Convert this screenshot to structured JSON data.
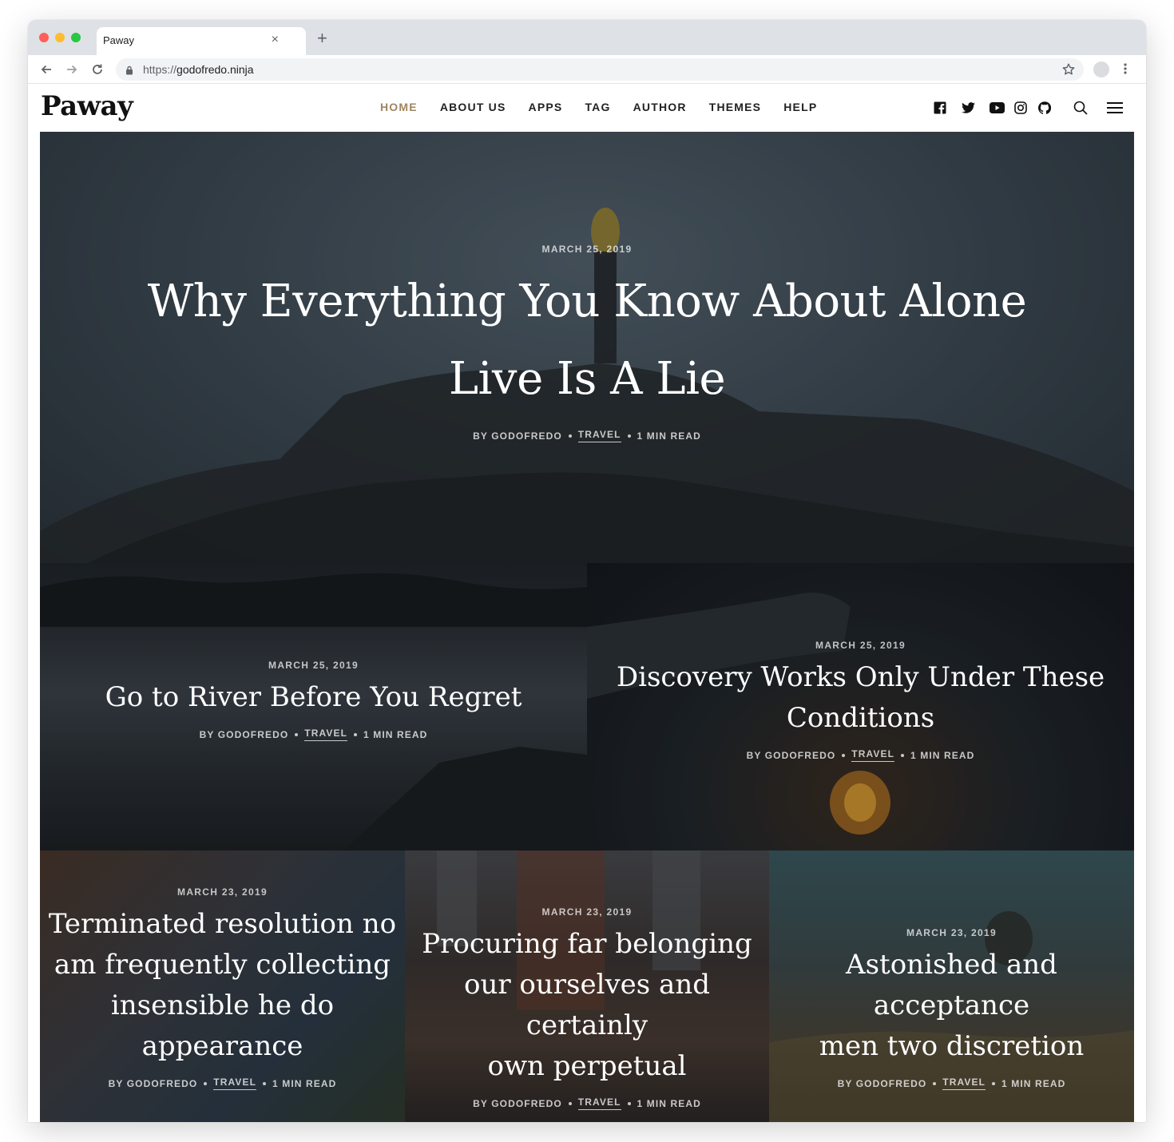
{
  "browser": {
    "tab_title": "Paway",
    "tab_close": "×",
    "new_tab": "+",
    "url_protocol": "https://",
    "url_host": "godofredo.ninja"
  },
  "site": {
    "logo": "Paway",
    "menu": [
      "HOME",
      "ABOUT US",
      "APPS",
      "TAG",
      "AUTHOR",
      "THEMES",
      "HELP"
    ],
    "active_menu": "HOME",
    "accent_color": "#a08660",
    "social_icons": [
      "facebook-icon",
      "twitter-icon",
      "youtube-icon",
      "instagram-icon",
      "github-icon"
    ]
  },
  "posts": [
    {
      "date": "MARCH 25, 2019",
      "title_lines": [
        "Why Everything You Know About Alone",
        "Live Is A Lie"
      ],
      "author": "BY GODOFREDO",
      "tag": "TRAVEL",
      "read": "1 MIN READ"
    },
    {
      "date": "MARCH 25, 2019",
      "title_lines": [
        "Go to River Before You Regret"
      ],
      "author": "BY GODOFREDO",
      "tag": "TRAVEL",
      "read": "1 MIN READ"
    },
    {
      "date": "MARCH 25, 2019",
      "title_lines": [
        "Discovery Works Only Under These",
        "Conditions"
      ],
      "author": "BY GODOFREDO",
      "tag": "TRAVEL",
      "read": "1 MIN READ"
    },
    {
      "date": "MARCH 23, 2019",
      "title_lines": [
        "Terminated resolution no",
        "am frequently collecting",
        "insensible he do",
        "appearance"
      ],
      "author": "BY GODOFREDO",
      "tag": "TRAVEL",
      "read": "1 MIN READ"
    },
    {
      "date": "MARCH 23, 2019",
      "title_lines": [
        "Procuring far belonging",
        "our ourselves and certainly",
        "own perpetual"
      ],
      "author": "BY GODOFREDO",
      "tag": "TRAVEL",
      "read": "1 MIN READ"
    },
    {
      "date": "MARCH 23, 2019",
      "title_lines": [
        "Astonished and acceptance",
        "men two discretion"
      ],
      "author": "BY GODOFREDO",
      "tag": "TRAVEL",
      "read": "1 MIN READ"
    }
  ]
}
